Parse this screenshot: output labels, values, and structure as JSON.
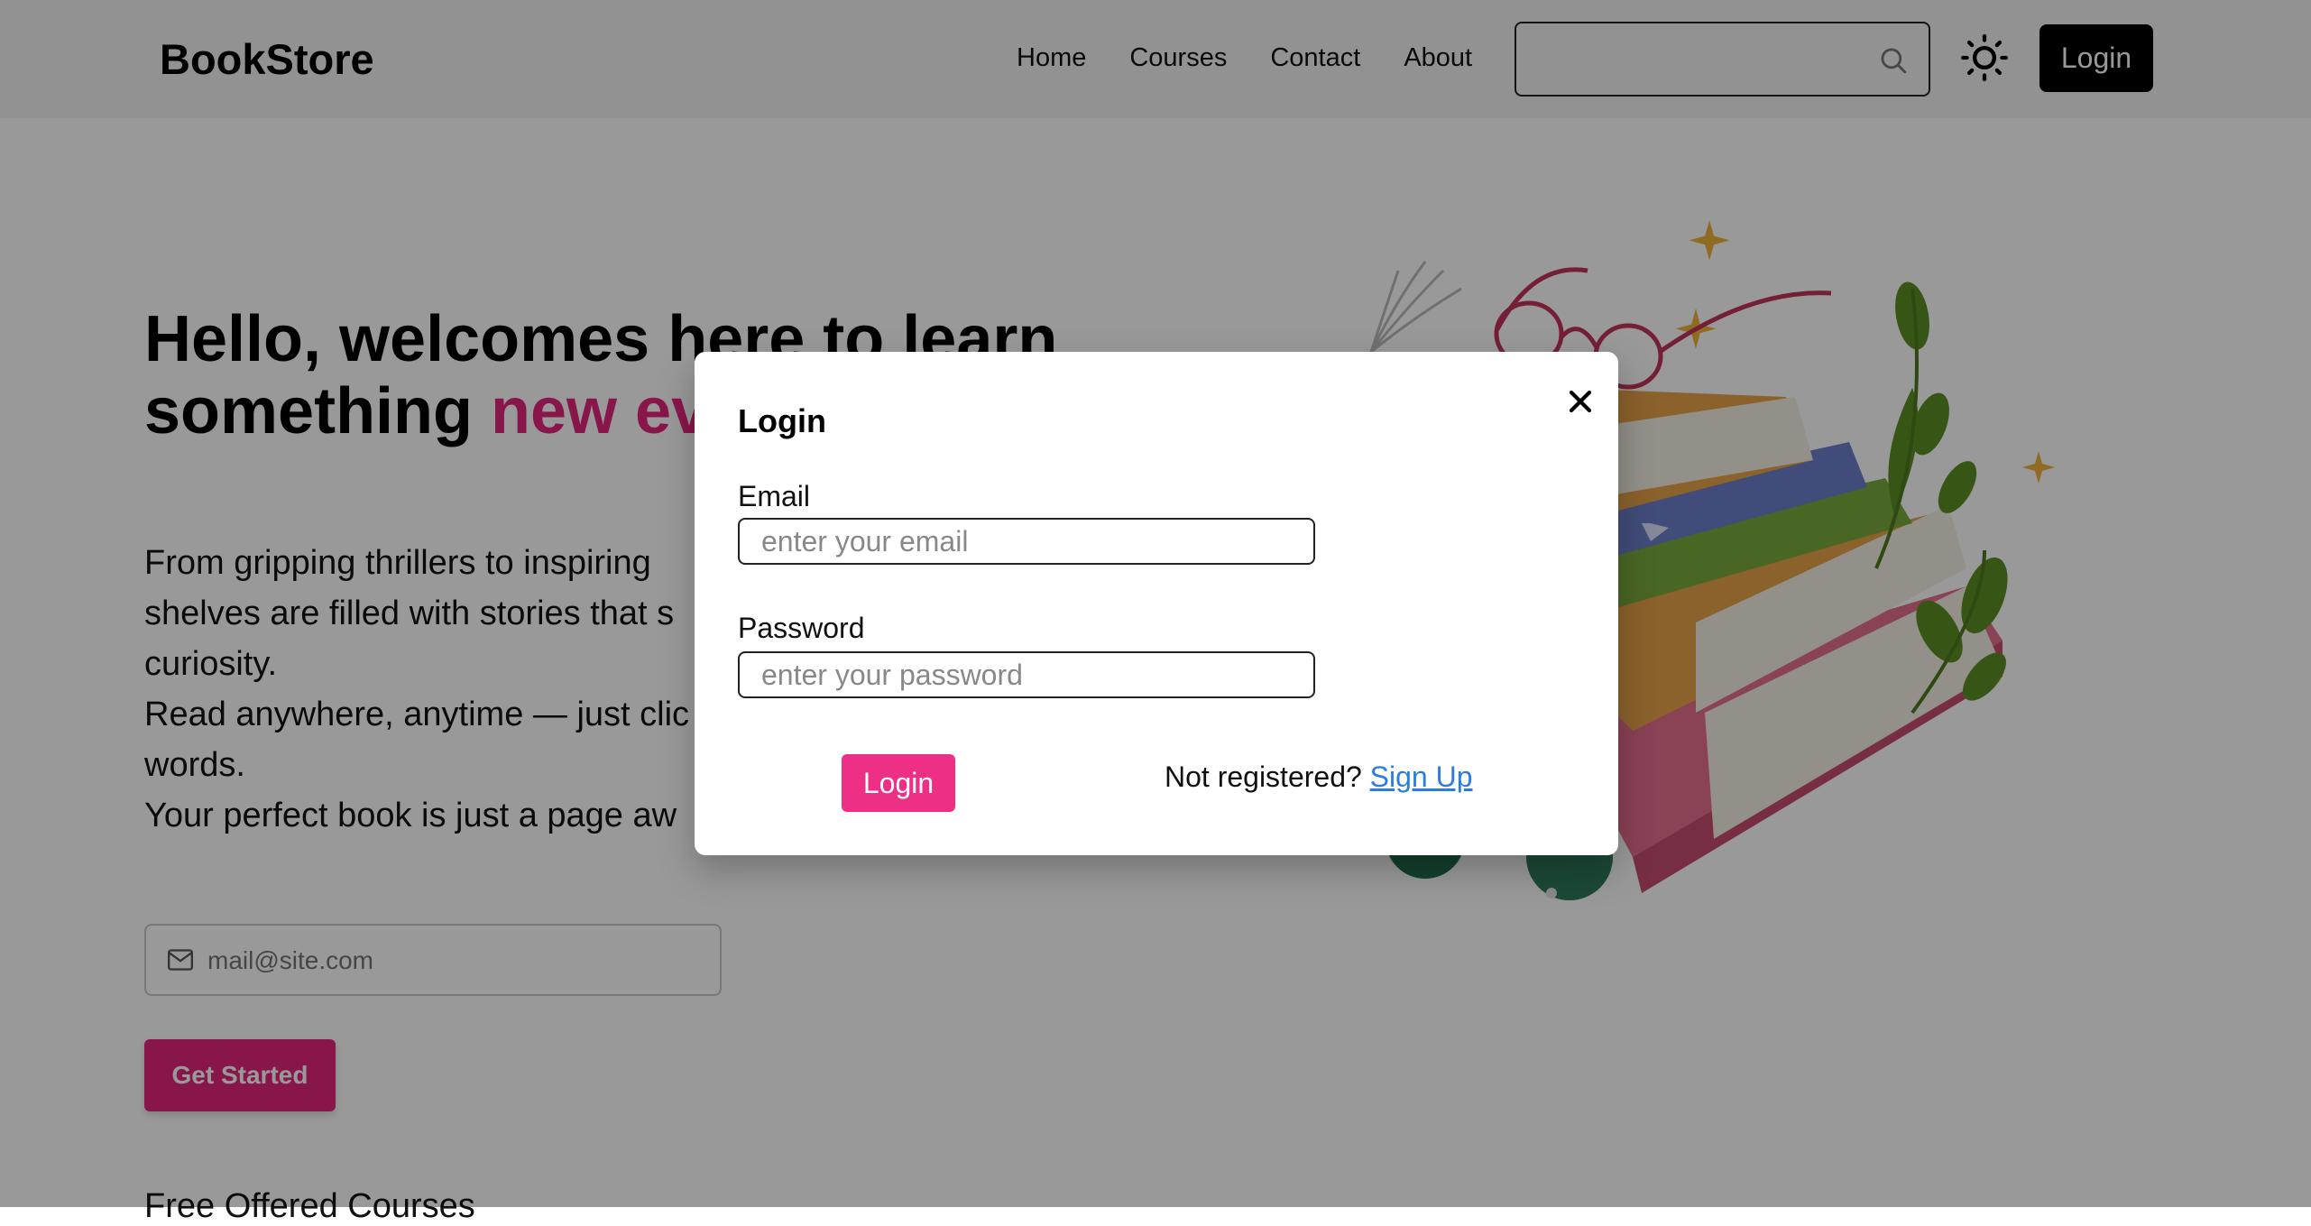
{
  "navbar": {
    "brand": "BookStore",
    "links": [
      "Home",
      "Courses",
      "Contact",
      "About"
    ],
    "search_placeholder": "",
    "login_label": "Login"
  },
  "hero": {
    "title_part1": "Hello, welcomes here to learn",
    "title_part2": "something ",
    "title_accent": "new everyday!!!",
    "desc_lines": [
      "From gripping thrillers to inspiring",
      "shelves are filled with stories that s",
      "curiosity.",
      "Read anywhere, anytime — just clic",
      "words.",
      "Your perfect book is just a page aw"
    ],
    "email_placeholder": "mail@site.com",
    "cta_label": "Get Started"
  },
  "section": {
    "heading": "Free Offered Courses"
  },
  "modal": {
    "title": "Login",
    "email_label": "Email",
    "email_placeholder": "enter your email",
    "password_label": "Password",
    "password_placeholder": "enter your password",
    "login_label": "Login",
    "signup_prompt": "Not registered? ",
    "signup_link": "Sign Up"
  },
  "colors": {
    "accent": "#e4267e",
    "link": "#2b7de0",
    "overlay": "rgba(0,0,0,0.4)"
  }
}
